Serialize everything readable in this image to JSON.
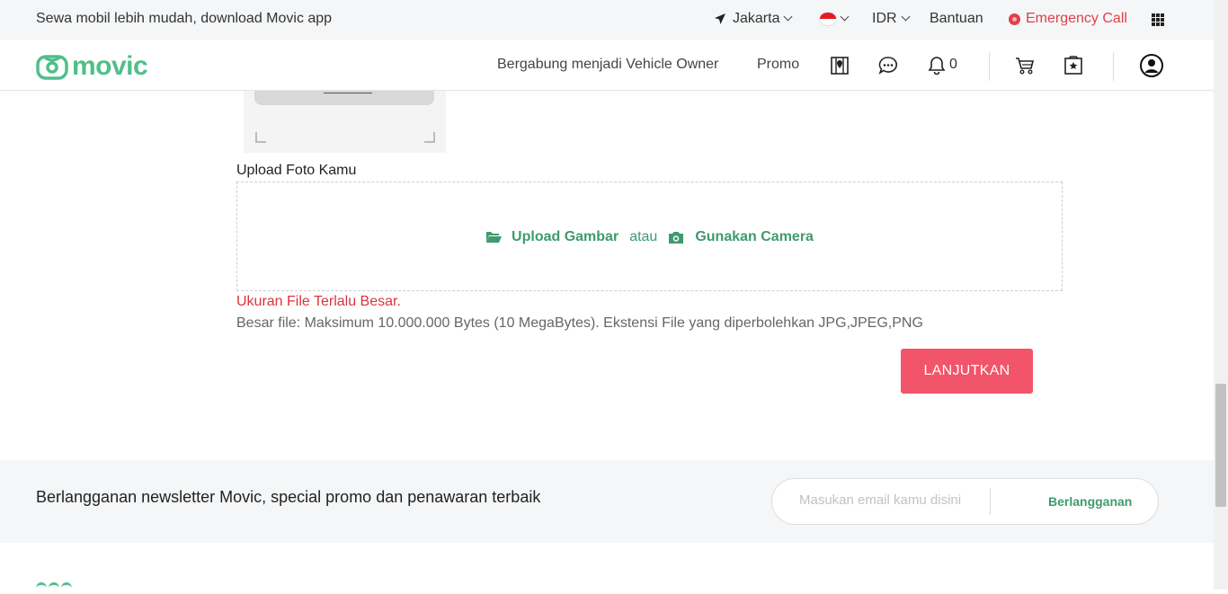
{
  "topbar": {
    "promo_text": "Sewa mobil lebih mudah, download Movic app",
    "city": "Jakarta",
    "currency": "IDR",
    "help": "Bantuan",
    "emergency": "Emergency Call"
  },
  "nav": {
    "logo_text": "movic",
    "owner_link": "Bergabung menjadi Vehicle Owner",
    "promo_link": "Promo",
    "notification_count": "0"
  },
  "upload": {
    "label": "Upload Foto Kamu",
    "upload_image": "Upload Gambar",
    "or": "atau",
    "use_camera": "Gunakan Camera",
    "error": "Ukuran File Terlalu Besar.",
    "hint": "Besar file: Maksimum 10.000.000 Bytes (10 MegaBytes). Ekstensi File yang diperbolehkan JPG,JPEG,PNG",
    "continue_button": "LANJUTKAN"
  },
  "newsletter": {
    "text": "Berlangganan newsletter Movic, special promo dan penawaran terbaik",
    "placeholder": "Masukan email kamu disini",
    "subscribe_button": "Berlangganan"
  },
  "colors": {
    "brand_green": "#4fbf8a",
    "action_red": "#f2546a",
    "error_red": "#d9343d"
  }
}
